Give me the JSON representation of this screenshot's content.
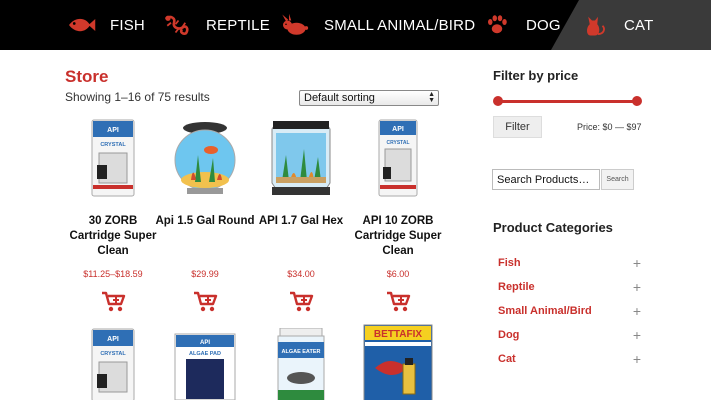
{
  "nav": {
    "items": [
      {
        "label": "FISH",
        "icon": "fish-icon"
      },
      {
        "label": "REPTILE",
        "icon": "lizard-icon"
      },
      {
        "label": "SMALL ANIMAL/BIRD",
        "icon": "rabbit-icon"
      },
      {
        "label": "DOG",
        "icon": "paw-icon"
      },
      {
        "label": "CAT",
        "icon": "cat-icon"
      }
    ],
    "accent": "#c9302c"
  },
  "store": {
    "title": "Store",
    "results_text": "Showing 1–16 of 75 results",
    "sort_selected": "Default sorting"
  },
  "products": [
    {
      "name": "30 ZORB Cartridge Super Clean",
      "price": "$11.25–$18.59"
    },
    {
      "name": "Api 1.5 Gal Round",
      "price": "$29.99"
    },
    {
      "name": "API 1.7 Gal Hex",
      "price": "$34.00"
    },
    {
      "name": "API 10 ZORB Cartridge Super Clean",
      "price": "$6.00"
    }
  ],
  "product_images": {
    "api_label": "API",
    "crystal_label": "CRYSTAL",
    "algae_pad_label": "ALGAE PAD",
    "algae_eater_label": "ALGAE EATER",
    "bettafix_label": "BETTAFIX"
  },
  "sidebar": {
    "filter_title": "Filter by price",
    "filter_button": "Filter",
    "price_range": "Price: $0 — $97",
    "search_placeholder": "Search Products…",
    "search_button": "Search",
    "categories_title": "Product Categories",
    "categories": [
      "Fish",
      "Reptile",
      "Small Animal/Bird",
      "Dog",
      "Cat"
    ]
  }
}
